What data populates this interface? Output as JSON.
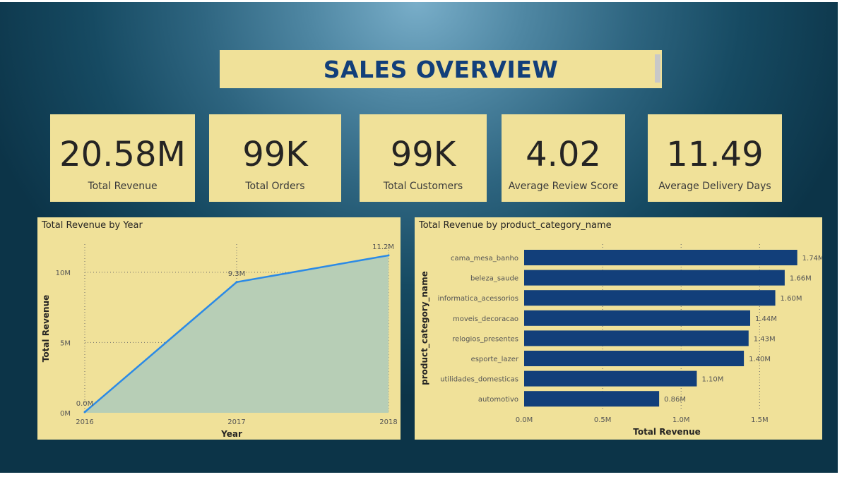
{
  "title": "SALES OVERVIEW",
  "kpis": [
    {
      "value": "20.58M",
      "label": "Total Revenue"
    },
    {
      "value": "99K",
      "label": "Total Orders"
    },
    {
      "value": "99K",
      "label": "Total Customers"
    },
    {
      "value": "4.02",
      "label": "Average Review Score"
    },
    {
      "value": "11.49",
      "label": "Average Delivery Days"
    }
  ],
  "colors": {
    "panel": "#f0e199",
    "title": "#123f7a",
    "line": "#2b8ae6",
    "area": "#b7ceb6",
    "bar": "#123f7a"
  },
  "chart_data": [
    {
      "type": "area",
      "title": "Total Revenue by Year",
      "xlabel": "Year",
      "ylabel": "Total Revenue",
      "x": [
        "2016",
        "2017",
        "2018"
      ],
      "values": [
        0.05,
        9.3,
        11.2
      ],
      "data_labels": [
        "0.0M",
        "9.3M",
        "11.2M"
      ],
      "yticks": [
        "0M",
        "5M",
        "10M"
      ],
      "ytick_values": [
        0,
        5,
        10
      ],
      "ylim": [
        0,
        12
      ],
      "grid": true
    },
    {
      "type": "bar",
      "orientation": "horizontal",
      "title": "Total Revenue by product_category_name",
      "xlabel": "Total Revenue",
      "ylabel": "product_category_name",
      "categories": [
        "cama_mesa_banho",
        "beleza_saude",
        "informatica_acessorios",
        "moveis_decoracao",
        "relogios_presentes",
        "esporte_lazer",
        "utilidades_domesticas",
        "automotivo"
      ],
      "values": [
        1.74,
        1.66,
        1.6,
        1.44,
        1.43,
        1.4,
        1.1,
        0.86
      ],
      "data_labels": [
        "1.74M",
        "1.66M",
        "1.60M",
        "1.44M",
        "1.43M",
        "1.40M",
        "1.10M",
        "0.86M"
      ],
      "xticks": [
        "0.0M",
        "0.5M",
        "1.0M",
        "1.5M"
      ],
      "xtick_values": [
        0,
        0.5,
        1.0,
        1.5
      ],
      "xlim": [
        0,
        1.8
      ],
      "grid": true
    }
  ]
}
